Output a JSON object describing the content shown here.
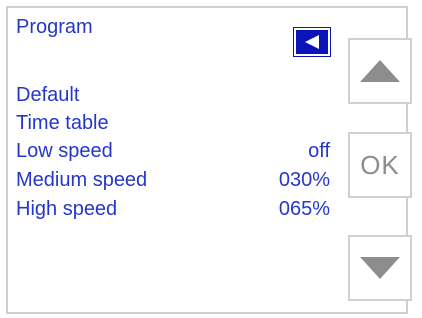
{
  "header": {
    "title": "Program",
    "back_icon": "back-triangle-left-icon"
  },
  "menu": [
    {
      "label": "Default",
      "value": ""
    },
    {
      "label": "Time table",
      "value": ""
    },
    {
      "label": "Low speed",
      "value": "off"
    },
    {
      "label": "Medium speed",
      "value": "030%"
    },
    {
      "label": "High speed",
      "value": "065%"
    }
  ],
  "side_buttons": {
    "up_icon": "arrow-up-icon",
    "ok_label": "OK",
    "down_icon": "arrow-down-icon"
  },
  "colors": {
    "text": "#2637c8",
    "back_button": "#0b14b8",
    "button_border": "#cfcfcf",
    "arrow": "#8d8d8d"
  }
}
